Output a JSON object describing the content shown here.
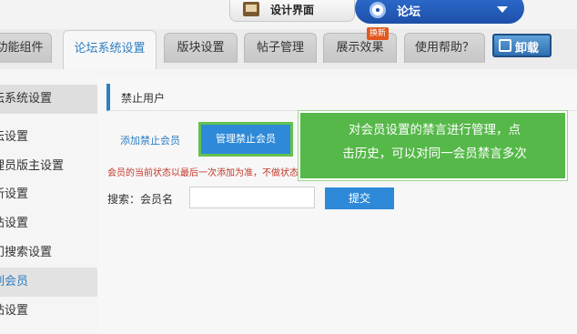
{
  "header": {
    "design_label": "设计界面",
    "forum_label": "论坛"
  },
  "tabs": [
    {
      "label": "功能组件"
    },
    {
      "label": "论坛系统设置"
    },
    {
      "label": "版块设置"
    },
    {
      "label": "帖子管理"
    },
    {
      "label": "展示效果"
    },
    {
      "label": "使用帮助？"
    }
  ],
  "new_badge": "换新",
  "uninstall_label": "卸载",
  "sidebar": {
    "items": [
      {
        "label": "坛系统设置"
      },
      {
        "label": "坛设置"
      },
      {
        "label": "理员版主设置"
      },
      {
        "label": "新设置"
      },
      {
        "label": "帖设置"
      },
      {
        "label": "门搜索设置"
      },
      {
        "label": "列会员"
      },
      {
        "label": "帖设置"
      }
    ]
  },
  "main": {
    "section_title": "禁止用户",
    "subtab_add": "添加禁止会员",
    "subtab_manage": "管理禁止会员",
    "note": "会员的当前状态以最后一次添加为准，不做状态为正常状态",
    "search_label": "搜索：会员名",
    "search_value": "",
    "submit_label": "提交"
  },
  "callout": {
    "line1": "对会员设置的禁言进行管理，点",
    "line2": "击历史，可以对同一会员禁言多次"
  },
  "colors": {
    "accent_blue": "#2e8ad8",
    "callout_green": "#56b849",
    "highlight_border": "#63c04f",
    "warning_red": "#c0392b"
  }
}
